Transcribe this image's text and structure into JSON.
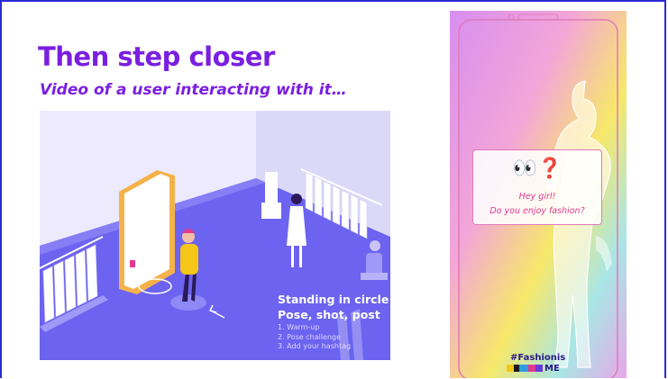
{
  "slide": {
    "title": "Then step closer",
    "subtitle": "Video of a user interacting with it…"
  },
  "illustration": {
    "overlay_title_line1": "Standing in circle 1",
    "overlay_title_line2": "Pose, shot, post",
    "steps": [
      "1. Warm-up",
      "2. Pose challenge",
      "3. Add your hashtag"
    ],
    "colors": {
      "floor": "#6c63f0",
      "wall": "#eceafc",
      "accent": "#f5c518"
    }
  },
  "phone": {
    "emoji": "👀❓",
    "greeting": "Hey girl!",
    "question": "Do you enjoy fashion?",
    "hashtag_line1": "#Fashionis",
    "hashtag_line2": "ME",
    "colors": {
      "frame": "#e07ab8",
      "text": "#e23a8f",
      "hashtag": "#2a1a8a"
    }
  }
}
